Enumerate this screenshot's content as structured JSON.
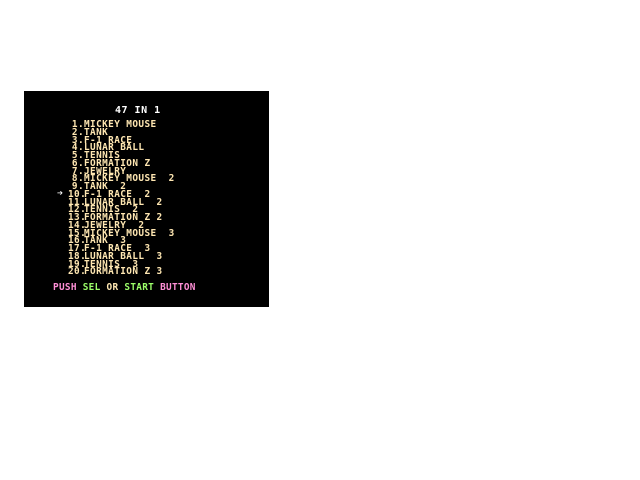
{
  "title": "47 IN 1",
  "menu": [
    {
      "num": "1.",
      "label": "MICKEY MOUSE"
    },
    {
      "num": "2.",
      "label": "TANK"
    },
    {
      "num": "3.",
      "label": "F-1 RACE"
    },
    {
      "num": "4.",
      "label": "LUNAR BALL"
    },
    {
      "num": "5.",
      "label": "TENNIS"
    },
    {
      "num": "6.",
      "label": "FORMATION Z"
    },
    {
      "num": "7.",
      "label": "JEWELRY"
    },
    {
      "num": "8.",
      "label": "MICKEY MOUSE  2"
    },
    {
      "num": "9.",
      "label": "TANK  2"
    },
    {
      "num": "10.",
      "label": "F-1 RACE  2"
    },
    {
      "num": "11.",
      "label": "LUNAR BALL  2"
    },
    {
      "num": "12.",
      "label": "TENNIS  2"
    },
    {
      "num": "13.",
      "label": "FORMATION Z 2"
    },
    {
      "num": "14.",
      "label": "JEWELRY  2"
    },
    {
      "num": "15.",
      "label": "MICKEY MOUSE  3"
    },
    {
      "num": "16.",
      "label": "TANK  3"
    },
    {
      "num": "17.",
      "label": "F-1 RACE  3"
    },
    {
      "num": "18.",
      "label": "LUNAR BALL  3"
    },
    {
      "num": "19.",
      "label": "TENNIS  3"
    },
    {
      "num": "20.",
      "label": "FORMATION Z 3"
    }
  ],
  "selected_index": 9,
  "cursor_icon": "arrow-right-icon",
  "prompt": {
    "push": "PUSH",
    "sel": "SEL",
    "or": "OR",
    "start": "START",
    "button": "BUTTON"
  },
  "colors": {
    "background": "#000000",
    "menu_text": "#ffe7b2",
    "title_text": "#ffffff",
    "push": "#ff8fd6",
    "sel": "#9cff6a",
    "or": "#ffe7b2",
    "start": "#9cff6a",
    "button": "#ff8fd6"
  }
}
